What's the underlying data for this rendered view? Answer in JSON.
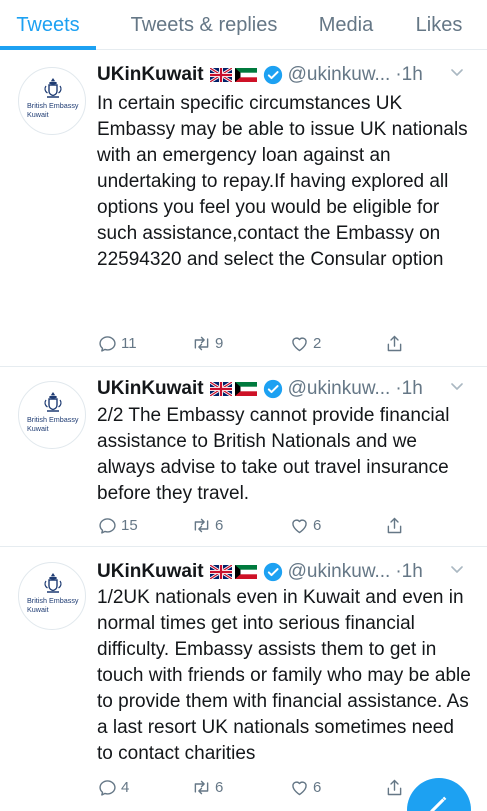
{
  "tabs": [
    {
      "label": "Tweets",
      "active": true
    },
    {
      "label": "Tweets & replies",
      "active": false
    },
    {
      "label": "Media",
      "active": false
    },
    {
      "label": "Likes",
      "active": false
    }
  ],
  "account": {
    "name": "UKinKuwait",
    "handle": "@ukinkuw...",
    "avatar_lines": [
      "British Embassy",
      "Kuwait"
    ],
    "flags": [
      "uk-flag-icon",
      "kuwait-flag-icon"
    ],
    "verified_icon": "verified-badge-icon"
  },
  "tweets": [
    {
      "time": "·1h",
      "text": "In certain specific circumstances UK Embassy may be able to issue UK nationals with an emergency loan against an undertaking to repay.If having explored all options you feel you would be eligible for such assistance,contact the Embassy on 22594320 and select the Consular option",
      "replies": "11",
      "retweets": "9",
      "likes": "2"
    },
    {
      "time": "·1h",
      "text": "2/2 The Embassy cannot provide financial assistance to British Nationals and we always advise to take out travel insurance before they travel.",
      "replies": "15",
      "retweets": "6",
      "likes": "6"
    },
    {
      "time": "·1h",
      "text": "1/2UK nationals even in Kuwait and even in normal times get into serious financial difficulty. Embassy assists them to get in touch with friends or family who may be able to provide them with financial assistance. As a last resort UK nationals sometimes need to contact charities",
      "replies": "4",
      "retweets": "6",
      "likes": "6"
    }
  ],
  "colors": {
    "accent": "#1da1f2",
    "secondary_text": "#657786",
    "divider": "#e6ecf0"
  },
  "icons": {
    "reply": "reply-icon",
    "retweet": "retweet-icon",
    "like": "heart-icon",
    "share": "share-icon",
    "more": "chevron-down-icon",
    "compose": "compose-tweet-icon"
  }
}
